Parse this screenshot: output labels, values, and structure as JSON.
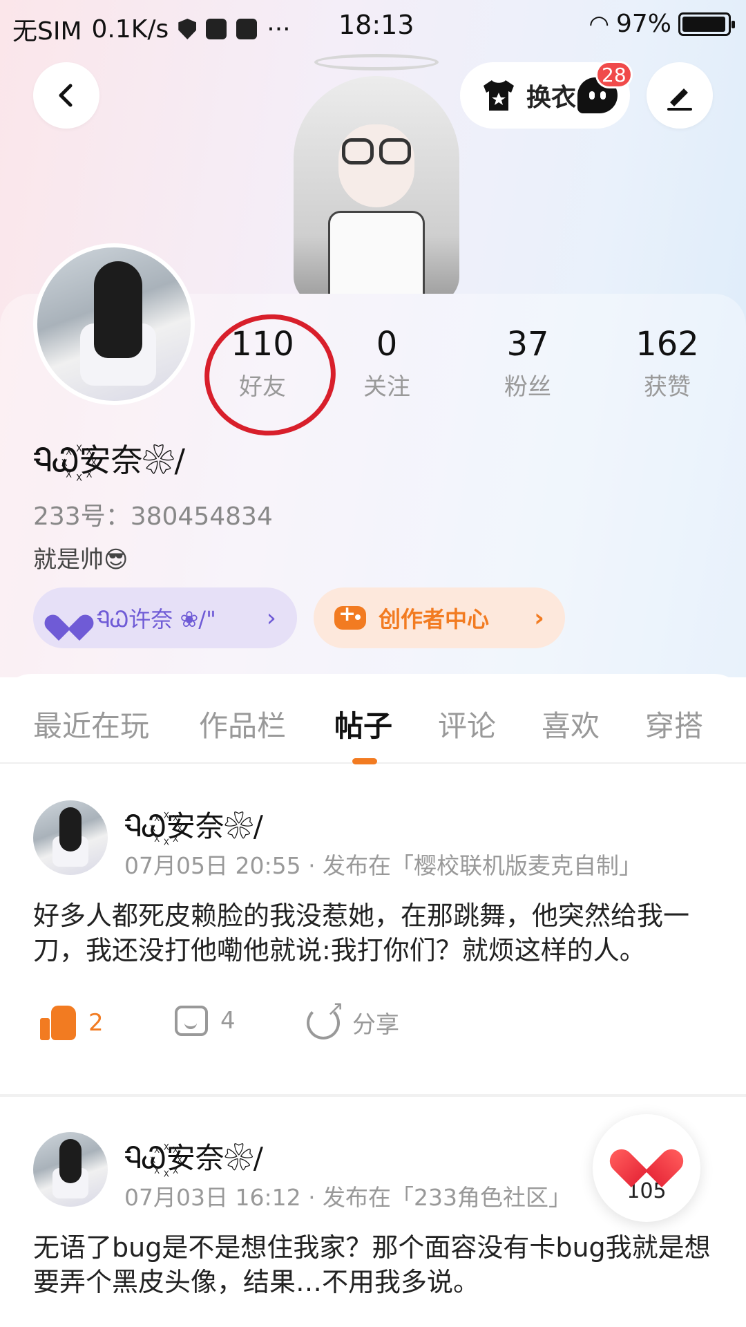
{
  "status_bar": {
    "carrier": "无SIM",
    "speed": "0.1K/s",
    "dots": "···",
    "time": "18:13",
    "battery": "97%",
    "battery_level": 0.97
  },
  "header": {
    "dress_label": "换衣",
    "message_badge": "28"
  },
  "stats": [
    {
      "num": "110",
      "label": "好友"
    },
    {
      "num": "0",
      "label": "关注"
    },
    {
      "num": "37",
      "label": "粉丝"
    },
    {
      "num": "162",
      "label": "获赞"
    }
  ],
  "profile": {
    "nickname": "ᏄᏇ꙰安奈❀/",
    "uid": "233号：380454834",
    "bio": "就是帅😎"
  },
  "chips": {
    "guard": "ᏄᏇ许奈 ❀/\"",
    "creator": "创作者中心"
  },
  "tabs": [
    {
      "label": "最近在玩"
    },
    {
      "label": "作品栏"
    },
    {
      "label": "帖子"
    },
    {
      "label": "评论"
    },
    {
      "label": "喜欢"
    },
    {
      "label": "穿搭"
    }
  ],
  "posts": [
    {
      "author": "ᏄᏇ꙰安奈❀/",
      "meta": "07月05日 20:55 · 发布在「樱校联机版麦克自制」",
      "text": "好多人都死皮赖脸的我没惹她，在那跳舞，他突然给我一刀，我还没打他嘞他就说:我打你们？就烦这样的人。",
      "likes": "2",
      "comments": "4",
      "share": "分享"
    },
    {
      "author": "ᏄᏇ꙰安奈❀/",
      "meta": "07月03日 16:12 · 发布在「233角色社区」",
      "text": "无语了bug是不是想住我家？那个面容没有卡bug我就是想要弄个黑皮头像，结果…不用我多说。"
    }
  ],
  "floating_like": {
    "count": "105"
  },
  "colors": {
    "accent": "#f27b21",
    "guard_purple": "#6f5bd6",
    "badge_red": "#f04a4a",
    "annotation_red": "#d81f2b"
  }
}
